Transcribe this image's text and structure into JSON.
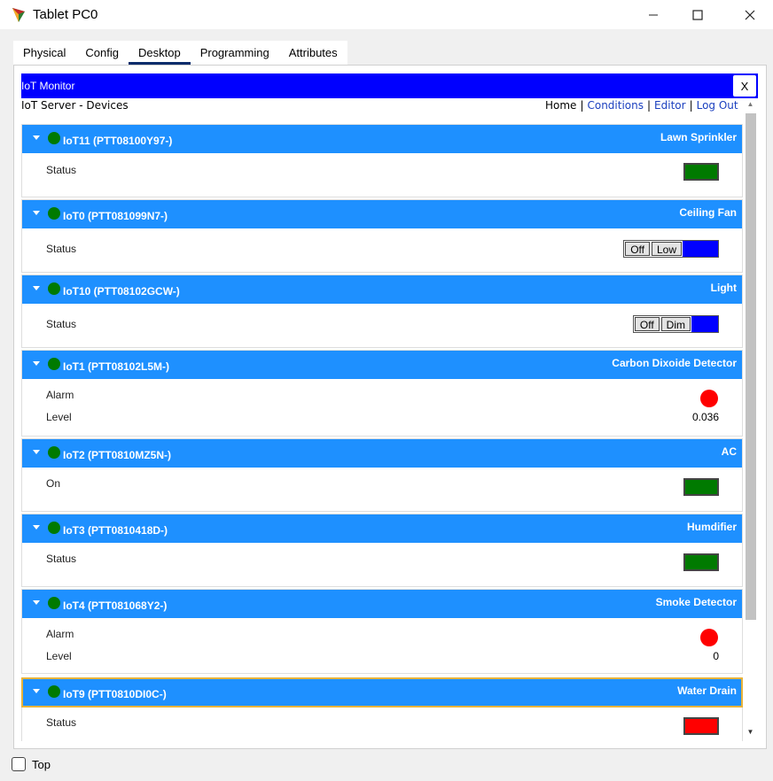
{
  "window": {
    "title": "Tablet PC0"
  },
  "tabs": [
    {
      "label": "Physical"
    },
    {
      "label": "Config"
    },
    {
      "label": "Desktop"
    },
    {
      "label": "Programming"
    },
    {
      "label": "Attributes"
    }
  ],
  "active_tab": "Desktop",
  "monitor": {
    "title": "IoT Monitor",
    "close_label": "X",
    "server_label": "IoT Server - Devices",
    "nav": {
      "home": "Home",
      "sep": "|",
      "conditions": "Conditions",
      "editor": "Editor",
      "logout": "Log Out"
    }
  },
  "devices": [
    {
      "name": "IoT11 (PTT08100Y97-)",
      "type": "Lawn Sprinkler",
      "rows": [
        {
          "label": "Status",
          "widget": "green-box"
        }
      ]
    },
    {
      "name": "IoT0 (PTT081099N7-)",
      "type": "Ceiling Fan",
      "rows": [
        {
          "label": "Status",
          "widget": "seg",
          "options": [
            "Off",
            "Low"
          ]
        }
      ]
    },
    {
      "name": "IoT10 (PTT08102GCW-)",
      "type": "Light",
      "rows": [
        {
          "label": "Status",
          "widget": "seg",
          "options": [
            "Off",
            "Dim"
          ]
        }
      ]
    },
    {
      "name": "IoT1 (PTT08102L5M-)",
      "type": "Carbon Dixoide Detector",
      "rows": [
        {
          "label": "Alarm",
          "widget": "red-circle"
        },
        {
          "label": "Level",
          "value": "0.036"
        }
      ]
    },
    {
      "name": "IoT2 (PTT0810MZ5N-)",
      "type": "AC",
      "rows": [
        {
          "label": "On",
          "widget": "green-box"
        }
      ]
    },
    {
      "name": "IoT3 (PTT0810418D-)",
      "type": "Humdifier",
      "rows": [
        {
          "label": "Status",
          "widget": "green-box"
        }
      ]
    },
    {
      "name": "IoT4 (PTT081068Y2-)",
      "type": "Smoke Detector",
      "rows": [
        {
          "label": "Alarm",
          "widget": "red-circle"
        },
        {
          "label": "Level",
          "value": "0"
        }
      ]
    },
    {
      "name": "IoT9 (PTT0810DI0C-)",
      "type": "Water Drain",
      "rows": [
        {
          "label": "Status",
          "widget": "red-box"
        }
      ]
    }
  ],
  "footer": {
    "top_label": "Top"
  },
  "colors": {
    "header_blue": "#1e90ff",
    "monitor_blue": "#0000ff",
    "status_green": "#007a00",
    "alarm_red": "#ff0000"
  }
}
